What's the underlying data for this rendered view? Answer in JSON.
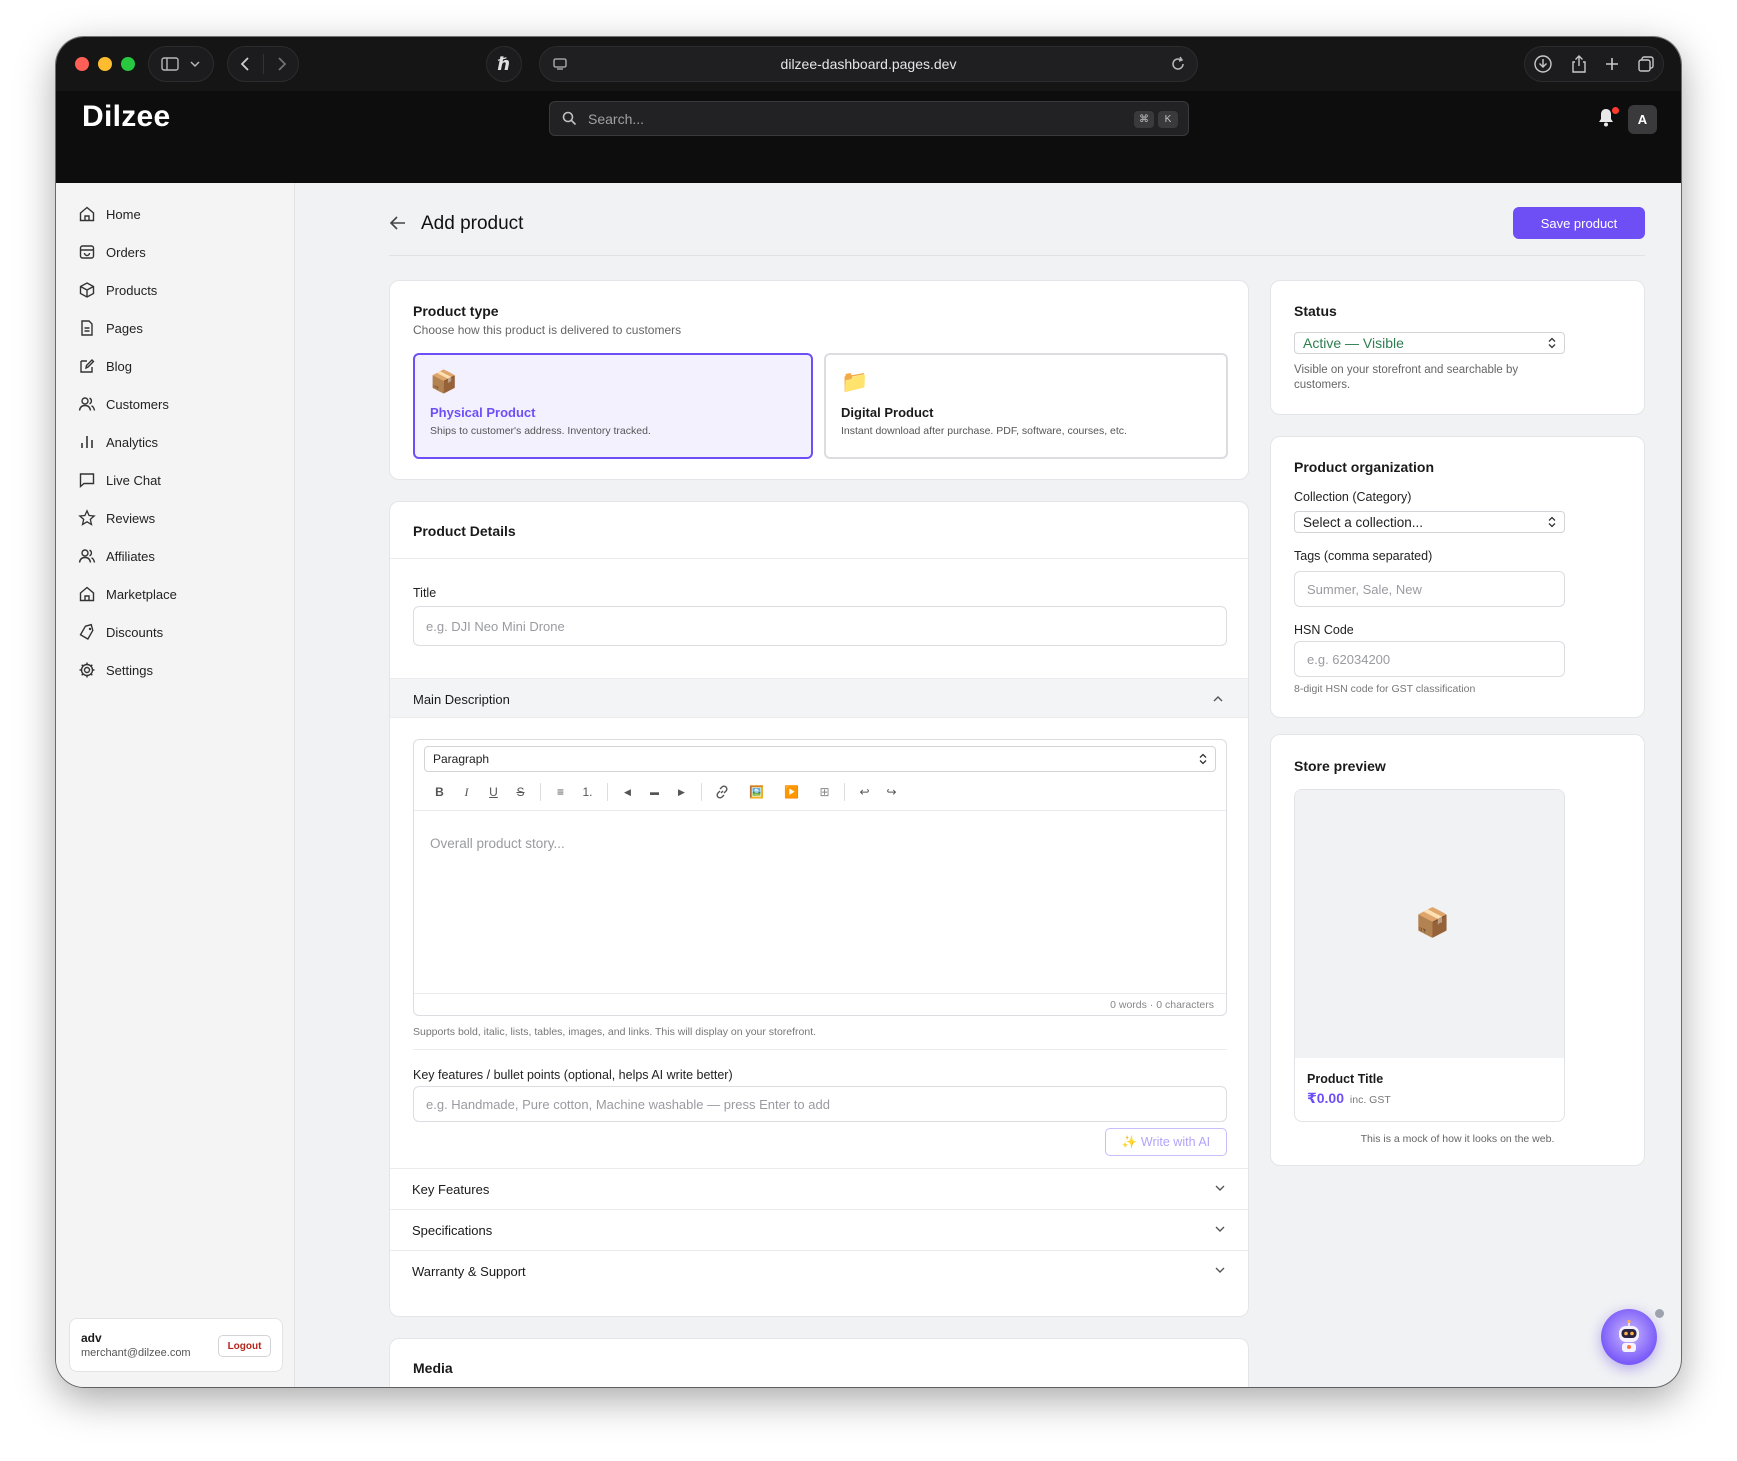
{
  "browser": {
    "url": "dilzee-dashboard.pages.dev"
  },
  "app": {
    "logo": "Dilzee",
    "search_placeholder": "Search...",
    "shortcut_key1": "⌘",
    "shortcut_key2": "K",
    "avatar_letter": "A"
  },
  "sidebar": {
    "items": [
      {
        "label": "Home",
        "icon": "home-icon"
      },
      {
        "label": "Orders",
        "icon": "orders-icon"
      },
      {
        "label": "Products",
        "icon": "products-icon"
      },
      {
        "label": "Pages",
        "icon": "pages-icon"
      },
      {
        "label": "Blog",
        "icon": "blog-icon"
      },
      {
        "label": "Customers",
        "icon": "customers-icon"
      },
      {
        "label": "Analytics",
        "icon": "analytics-icon"
      },
      {
        "label": "Live Chat",
        "icon": "chat-icon"
      },
      {
        "label": "Reviews",
        "icon": "star-icon"
      },
      {
        "label": "Affiliates",
        "icon": "affiliates-icon"
      },
      {
        "label": "Marketplace",
        "icon": "marketplace-icon"
      },
      {
        "label": "Discounts",
        "icon": "discount-icon"
      },
      {
        "label": "Settings",
        "icon": "gear-icon"
      }
    ],
    "user": {
      "name": "adv",
      "email": "merchant@dilzee.com",
      "logout": "Logout"
    }
  },
  "page": {
    "title": "Add product",
    "save_label": "Save product"
  },
  "product_type": {
    "title": "Product type",
    "subtitle": "Choose how this product is delivered to customers",
    "physical": {
      "name": "Physical Product",
      "desc": "Ships to customer's address. Inventory tracked.",
      "icon": "📦"
    },
    "digital": {
      "name": "Digital Product",
      "desc": "Instant download after purchase. PDF, software, courses, etc.",
      "icon": "📁"
    },
    "selected": "physical"
  },
  "details": {
    "title": "Product Details",
    "title_label": "Title",
    "title_placeholder": "e.g. DJI Neo Mini Drone",
    "main_desc_label": "Main Description",
    "paragraph_select": "Paragraph",
    "editor_placeholder": "Overall product story...",
    "counter": "0 words · 0 characters",
    "editor_hint": "Supports bold, italic, lists, tables, images, and links. This will display on your storefront.",
    "bullets_label": "Key features / bullet points (optional, helps AI write better)",
    "bullets_placeholder": "e.g. Handmade, Pure cotton, Machine washable — press Enter to add",
    "ai_button": "✨ Write with AI",
    "sections": [
      "Key Features",
      "Specifications",
      "Warranty & Support"
    ]
  },
  "toolbar_glyphs": {
    "bold": "B",
    "italic": "I",
    "underline": "U",
    "strike": "S",
    "bullets": "≡",
    "numbered": "1.",
    "align_left": "◀",
    "align_center": "▬",
    "align_right": "▶",
    "image": "🖼️",
    "video": "▶️",
    "table": "⊞",
    "undo": "↩",
    "redo": "↪"
  },
  "media": {
    "title": "Media"
  },
  "status": {
    "title": "Status",
    "value": "Active — Visible",
    "hint": "Visible on your storefront and searchable by customers.",
    "color": "#2e7d4f"
  },
  "organization": {
    "title": "Product organization",
    "collection_label": "Collection (Category)",
    "collection_value": "Select a collection...",
    "tags_label": "Tags (comma separated)",
    "tags_placeholder": "Summer, Sale, New",
    "hsn_label": "HSN Code",
    "hsn_placeholder": "e.g. 62034200",
    "hsn_hint": "8-digit HSN code for GST classification"
  },
  "preview": {
    "title": "Store preview",
    "product_title": "Product Title",
    "price": "₹0.00",
    "price_note": "inc. GST",
    "note": "This is a mock of how it looks on the web.",
    "icon": "📦"
  },
  "colors": {
    "accent": "#6e4ff6",
    "accent_text": "#6e4ff6"
  }
}
